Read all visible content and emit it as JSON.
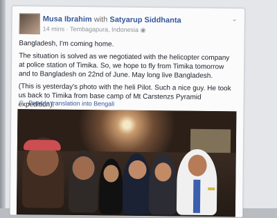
{
  "post": {
    "author": "Musa Ibrahim",
    "with_text": "with",
    "tagged": "Satyarup Siddhanta",
    "time": "14 mins",
    "location": "Tembagapura, Indonesia",
    "privacy_icon": "globe-icon",
    "menu_icon": "chevron-down-icon",
    "paragraphs": [
      "Bangladesh, I'm coming home.",
      "The situation is solved as we negotiated with the helicopter company at police station of Timika. So, we hope to fly from Timika tomorrow and to Bangladesh on 22nd of June. May long live Bangladesh.",
      "(This is yesterday's photo with the heli Pilot. Such a nice guy. He took us back to Timika from base camp of Mt Carstenzs Pyramid expedition)."
    ],
    "translate_label": "Provide translation into Bengali",
    "translate_icon": "gear-icon"
  }
}
